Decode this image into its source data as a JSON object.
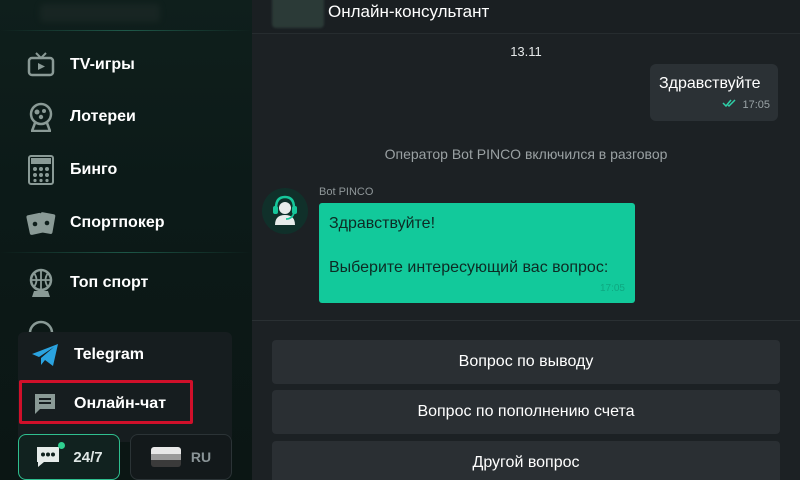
{
  "sidebar": {
    "items": [
      {
        "label": "TV-игры",
        "icon": "tv-icon"
      },
      {
        "label": "Лотереи",
        "icon": "lottery-icon"
      },
      {
        "label": "Бинго",
        "icon": "bingo-icon"
      },
      {
        "label": "Спортпокер",
        "icon": "cards-icon"
      },
      {
        "label": "Топ спорт",
        "icon": "basketball-icon"
      }
    ],
    "telegram": {
      "label": "Telegram",
      "icon": "telegram-icon"
    },
    "online_chat": {
      "label": "Онлайн-чат",
      "icon": "chat-icon"
    },
    "support_button": {
      "label": "24/7",
      "icon": "support-chat-icon"
    },
    "language_button": {
      "label": "RU",
      "icon": "flag-icon"
    }
  },
  "chat": {
    "header_title": "Онлайн-консультант",
    "date": "13.11",
    "outgoing": {
      "text": "Здравствуйте",
      "time": "17:05"
    },
    "system_message": "Оператор Bot PINCO включился в разговор",
    "bot": {
      "name": "Bot PINCO",
      "line1": "Здравствуйте!",
      "line2": "Выберите интересующий вас вопрос:",
      "time": "17:05"
    },
    "quick_replies": [
      "Вопрос по выводу",
      "Вопрос по пополнению счета",
      "Другой вопрос"
    ]
  },
  "colors": {
    "accent": "#12c99b",
    "highlight": "#d0102a",
    "sidebar_bg": "#0f1f1c",
    "chat_bg": "#1c2124"
  }
}
